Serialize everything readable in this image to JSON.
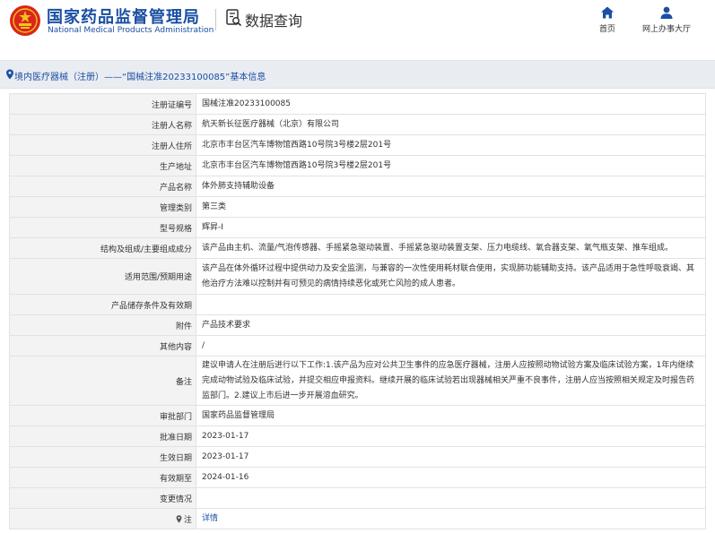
{
  "header": {
    "org_name_cn": "国家药品监督管理局",
    "org_name_en": "National Medical Products Administration",
    "section_title": "数据查询",
    "nav": [
      {
        "label": "首页",
        "icon": "home-icon"
      },
      {
        "label": "网上办事大厅",
        "icon": "user-icon"
      }
    ]
  },
  "breadcrumb": {
    "text": "境内医疗器械（注册）——“国械注准20233100085”基本信息"
  },
  "colors": {
    "brand_blue": "#1a4fa3",
    "emblem_red": "#d9261c",
    "emblem_gold": "#f2c21b",
    "label_bg": "#f3f3f3",
    "breadcrumb_bg": "#e9edf2"
  },
  "rows": [
    {
      "label": "注册证编号",
      "value": "国械注准20233100085"
    },
    {
      "label": "注册人名称",
      "value": "航天新长征医疗器械（北京）有限公司"
    },
    {
      "label": "注册人住所",
      "value": "北京市丰台区汽车博物馆西路10号院3号楼2层201号"
    },
    {
      "label": "生产地址",
      "value": "北京市丰台区汽车博物馆西路10号院3号楼2层201号"
    },
    {
      "label": "产品名称",
      "value": "体外肺支持辅助设备"
    },
    {
      "label": "管理类别",
      "value": "第三类"
    },
    {
      "label": "型号规格",
      "value": "辉昇-I"
    },
    {
      "label": "结构及组成/主要组成成分",
      "value": "该产品由主机、流量/气泡传感器、手摇紧急驱动装置、手摇紧急驱动装置支架、压力电缆线、氧合器支架、氧气瓶支架、推车组成。"
    },
    {
      "label": "适用范围/预期用途",
      "value": "该产品在体外循环过程中提供动力及安全监测，与兼容的一次性使用耗材联合使用，实现肺功能辅助支持。该产品适用于急性呼吸衰竭、其他治疗方法难以控制并有可预见的病情持续恶化或死亡风险的成人患者。"
    },
    {
      "label": "产品储存条件及有效期",
      "value": ""
    },
    {
      "label": "附件",
      "value": "产品技术要求"
    },
    {
      "label": "其他内容",
      "value": "/"
    },
    {
      "label": "备注",
      "value": "建议申请人在注册后进行以下工作:1.该产品为应对公共卫生事件的应急医疗器械，注册人应按照动物试验方案及临床试验方案，1年内继续完成动物试验及临床试验，并提交相应申报资料。继续开展的临床试验若出现器械相关严重不良事件，注册人应当按照相关规定及时报告药监部门。2.建议上市后进一步开展溶血研究。"
    },
    {
      "label": "审批部门",
      "value": "国家药品监督管理局"
    },
    {
      "label": "批准日期",
      "value": "2023-01-17"
    },
    {
      "label": "生效日期",
      "value": "2023-01-17"
    },
    {
      "label": "有效期至",
      "value": "2024-01-16"
    },
    {
      "label": "变更情况",
      "value": ""
    },
    {
      "label": "注",
      "value": "详情",
      "icon": "location-pin-icon"
    }
  ]
}
